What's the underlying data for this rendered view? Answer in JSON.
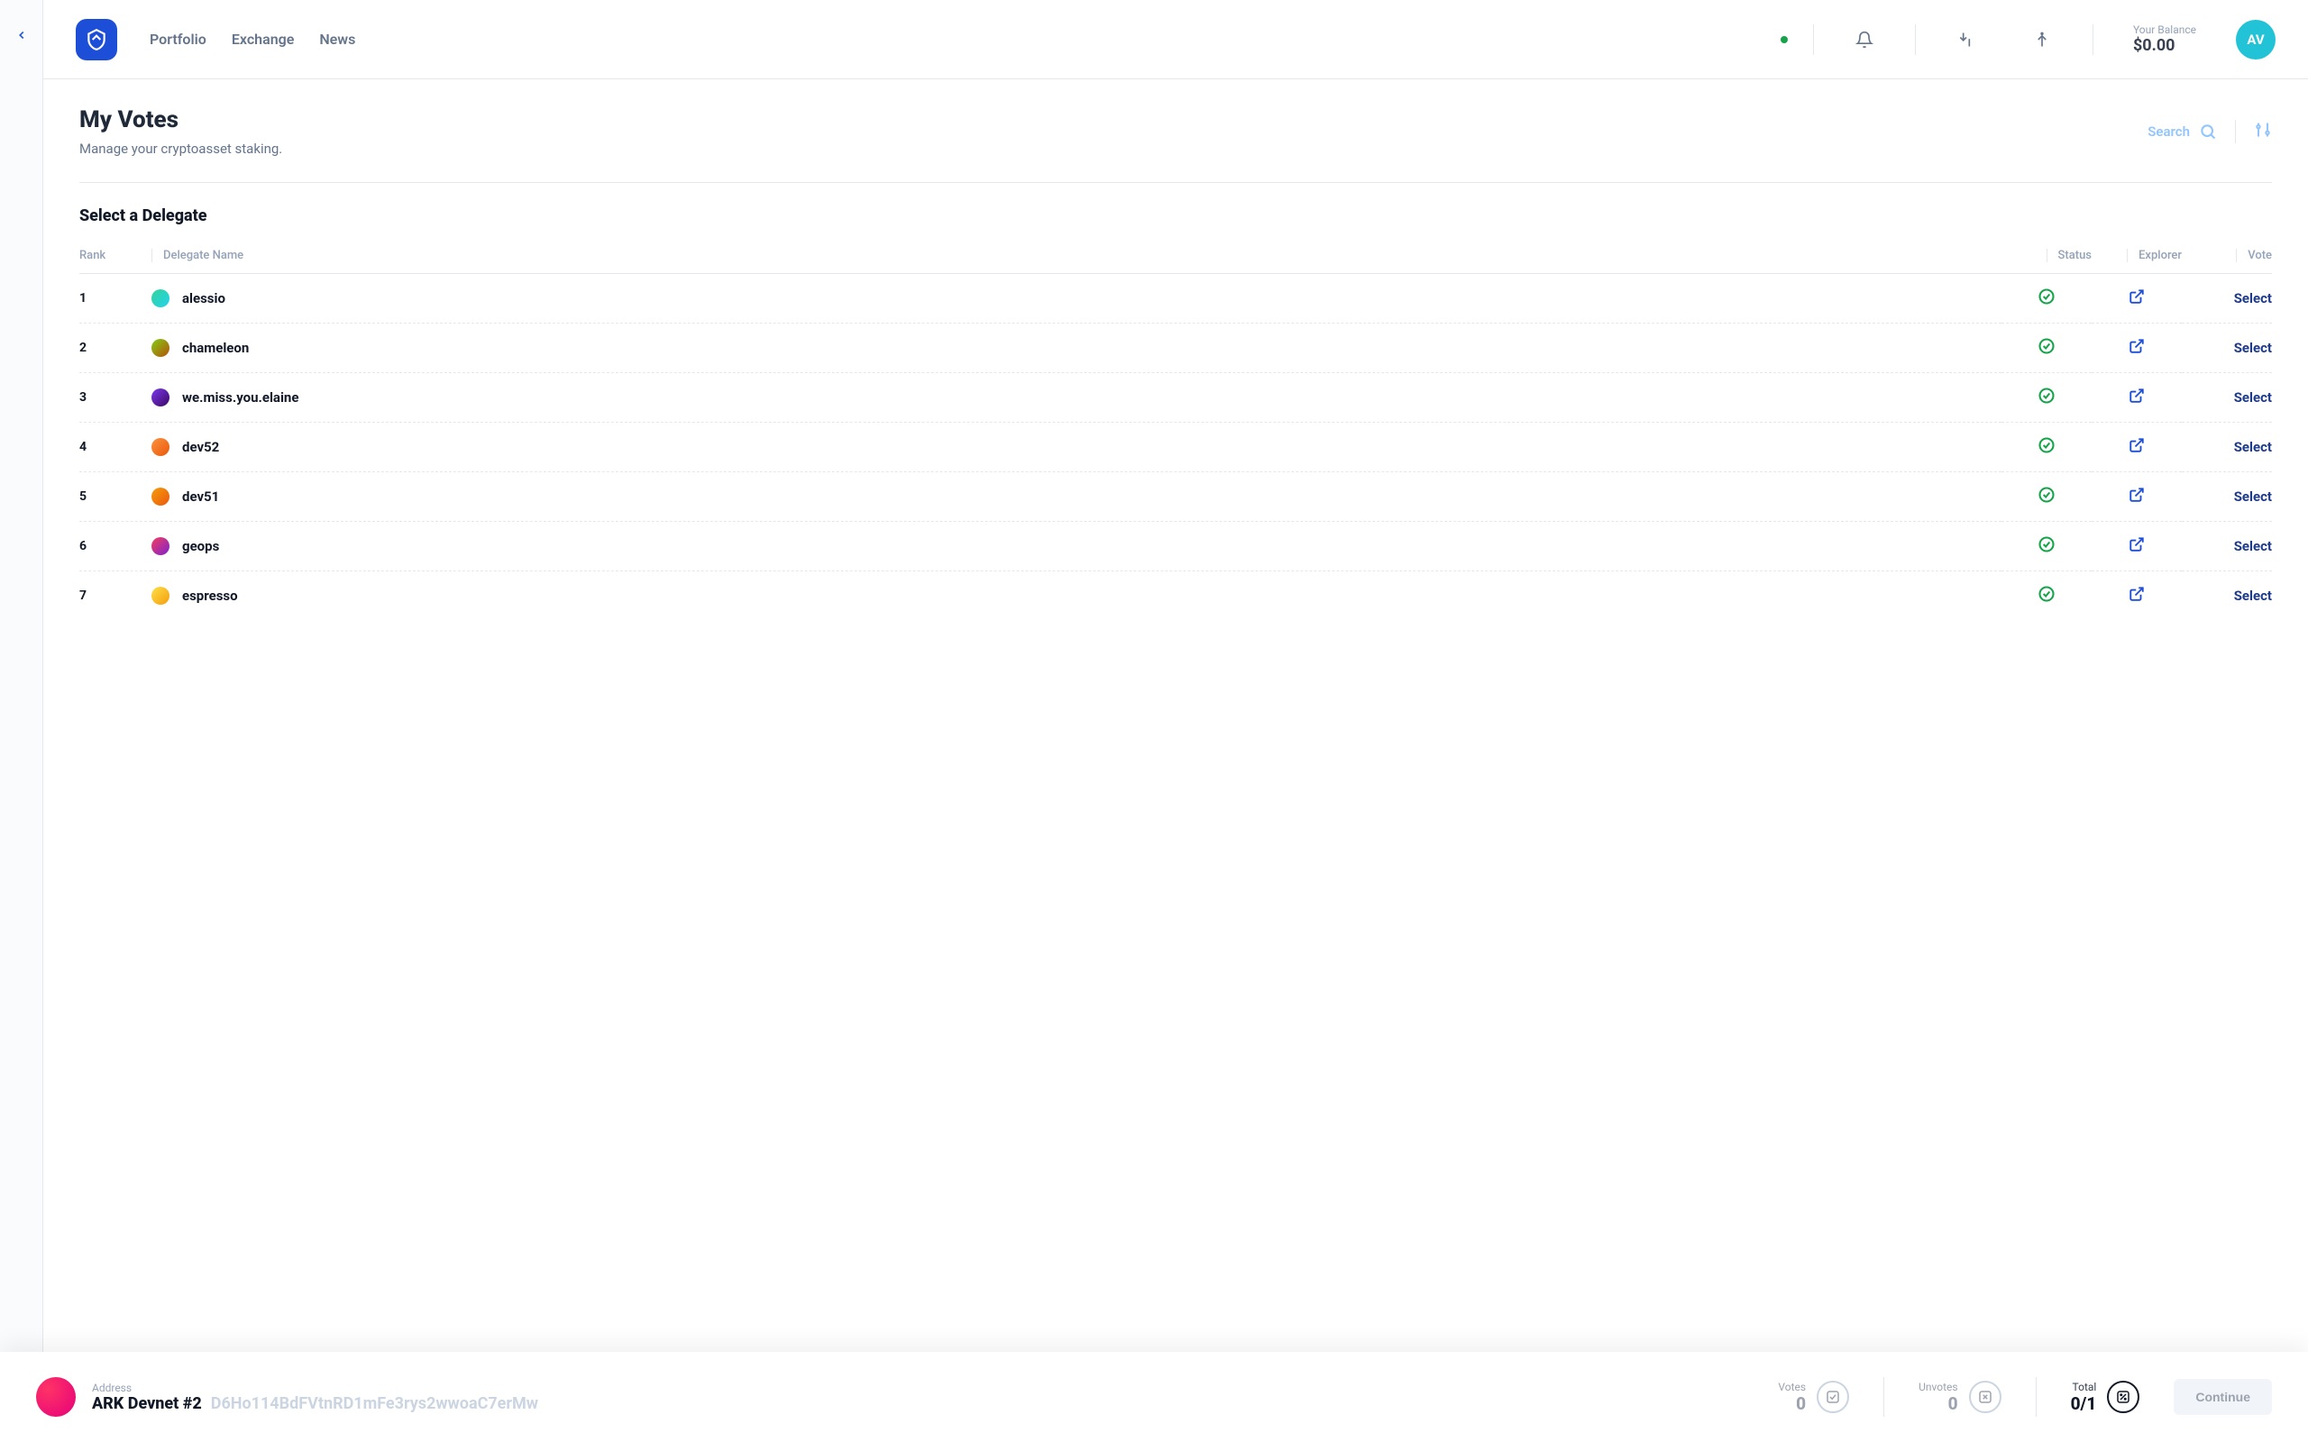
{
  "nav": {
    "portfolio": "Portfolio",
    "exchange": "Exchange",
    "news": "News"
  },
  "balance": {
    "label": "Your Balance",
    "amount": "$0.00"
  },
  "avatar": {
    "initials": "AV"
  },
  "page": {
    "title": "My Votes",
    "description": "Manage your cryptoasset staking.",
    "search_label": "Search",
    "section_title": "Select a Delegate"
  },
  "table": {
    "headers": {
      "rank": "Rank",
      "name": "Delegate Name",
      "status": "Status",
      "explorer": "Explorer",
      "vote": "Vote"
    },
    "select_label": "Select"
  },
  "delegates": [
    {
      "rank": "1",
      "name": "alessio",
      "color": "linear-gradient(135deg,#34d399,#22d3ee)"
    },
    {
      "rank": "2",
      "name": "chameleon",
      "color": "linear-gradient(135deg,#84cc16,#b45309)"
    },
    {
      "rank": "3",
      "name": "we.miss.you.elaine",
      "color": "linear-gradient(135deg,#7c3aed,#3b0764)"
    },
    {
      "rank": "4",
      "name": "dev52",
      "color": "linear-gradient(135deg,#fb923c,#ea580c)"
    },
    {
      "rank": "5",
      "name": "dev51",
      "color": "linear-gradient(135deg,#f59e0b,#ea580c)"
    },
    {
      "rank": "6",
      "name": "geops",
      "color": "linear-gradient(135deg,#f43f5e,#7e22ce)"
    },
    {
      "rank": "7",
      "name": "espresso",
      "color": "linear-gradient(135deg,#fde047,#f59e0b)"
    }
  ],
  "footer": {
    "address_label": "Address",
    "wallet_name": "ARK Devnet #2",
    "wallet_address": "D6Ho114BdFVtnRD1mFe3rys2wwoaC7erMw",
    "votes": {
      "label": "Votes",
      "value": "0"
    },
    "unvotes": {
      "label": "Unvotes",
      "value": "0"
    },
    "total": {
      "label": "Total",
      "value": "0/1"
    },
    "continue_label": "Continue"
  }
}
